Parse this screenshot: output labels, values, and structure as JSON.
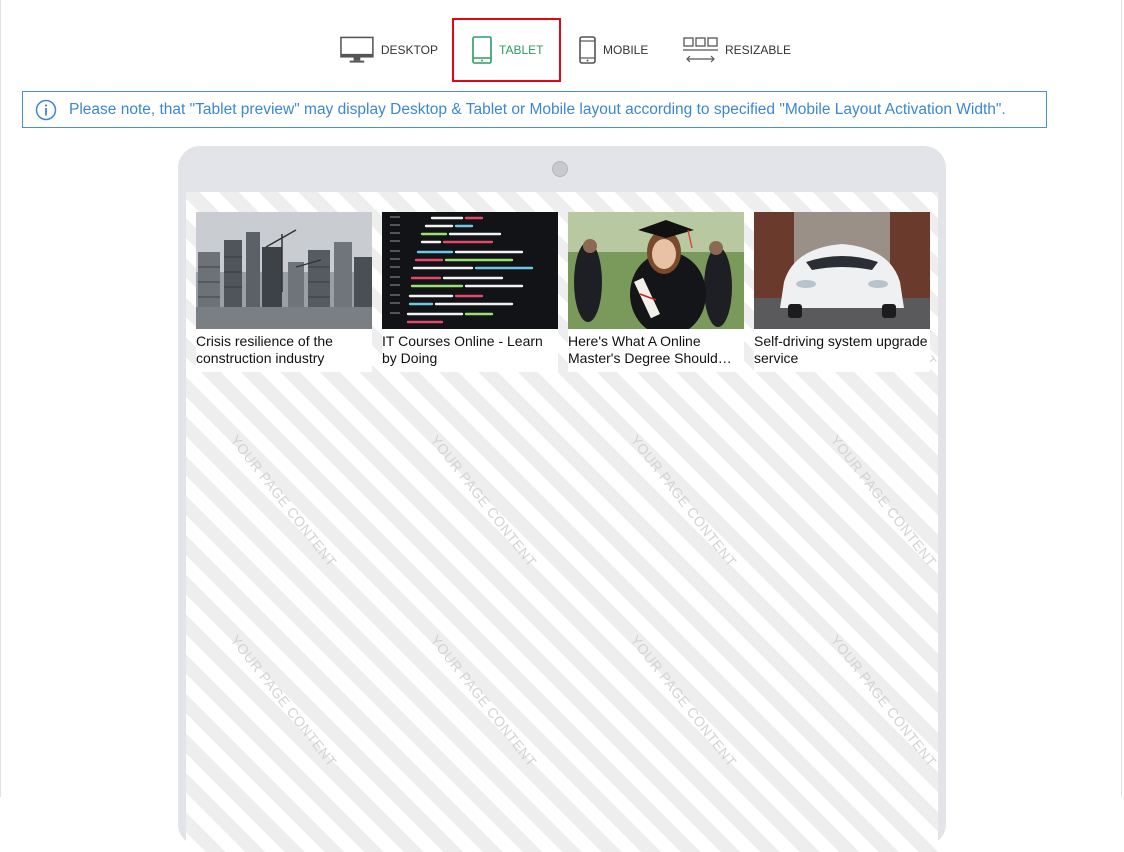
{
  "device_switcher": {
    "desktop_label": "DESKTOP",
    "tablet_label": "TABLET",
    "mobile_label": "MOBILE",
    "resizable_label": "RESIZABLE",
    "active": "tablet"
  },
  "note": {
    "text": "Please note, that \"Tablet preview\" may display Desktop & Tablet or Mobile layout according to specified \"Mobile Layout Activation Width\"."
  },
  "preview": {
    "watermark": "YOUR PAGE CONTENT",
    "cards": [
      {
        "image": "construction-city-image",
        "title": "Crisis resilience of the construction industry"
      },
      {
        "image": "code-screen-image",
        "title": "IT Courses Online - Learn by Doing"
      },
      {
        "image": "graduate-image",
        "title": "Here's What A Online Master's Degree Should Cost You"
      },
      {
        "image": "white-car-image",
        "title": "Self-driving system upgrade service"
      }
    ]
  },
  "colors": {
    "active_border": "#e30613",
    "active_text": "#2e9b63",
    "info_blue": "#3d86d6"
  }
}
